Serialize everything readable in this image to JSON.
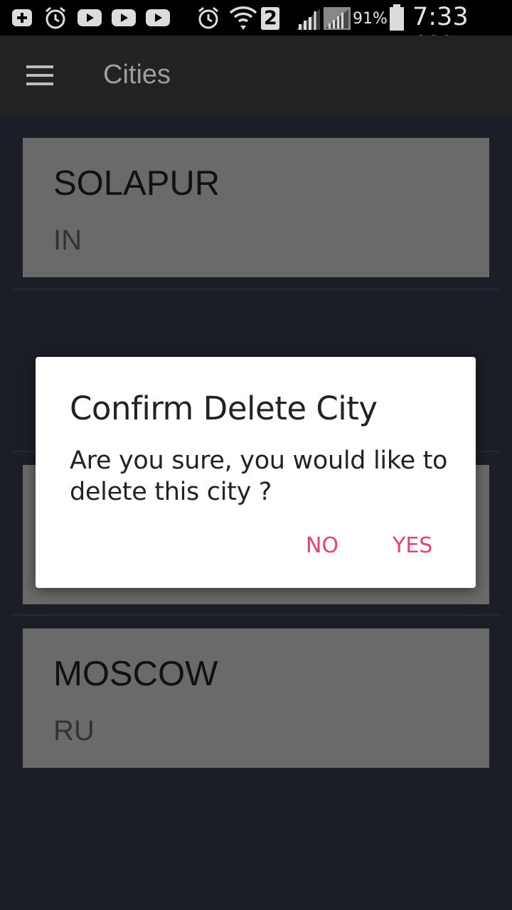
{
  "status_bar": {
    "sim_badge": "2",
    "battery_percent": "91%",
    "time": "7:33 AM",
    "icons": [
      "add-notification-icon",
      "alarm-icon",
      "youtube-icon",
      "youtube-icon",
      "youtube-icon",
      "alarm-icon",
      "wifi-icon",
      "signal-icon",
      "signal-icon",
      "battery-icon"
    ]
  },
  "app_bar": {
    "title": "Cities",
    "menu_icon": "hamburger-menu-icon"
  },
  "cities": [
    {
      "name": "SOLAPUR",
      "country": "IN"
    },
    {
      "name": "",
      "country": ""
    },
    {
      "name": "MOSCOW",
      "country": "RU"
    }
  ],
  "dialog": {
    "title": "Confirm Delete City",
    "message": "Are you sure, you would like to delete this city ?",
    "no_label": "NO",
    "yes_label": "YES",
    "accent_color": "#ea3d7a"
  },
  "colors": {
    "background": "#1b1e26",
    "app_bar": "#222222",
    "card": "#6a6a6a"
  }
}
